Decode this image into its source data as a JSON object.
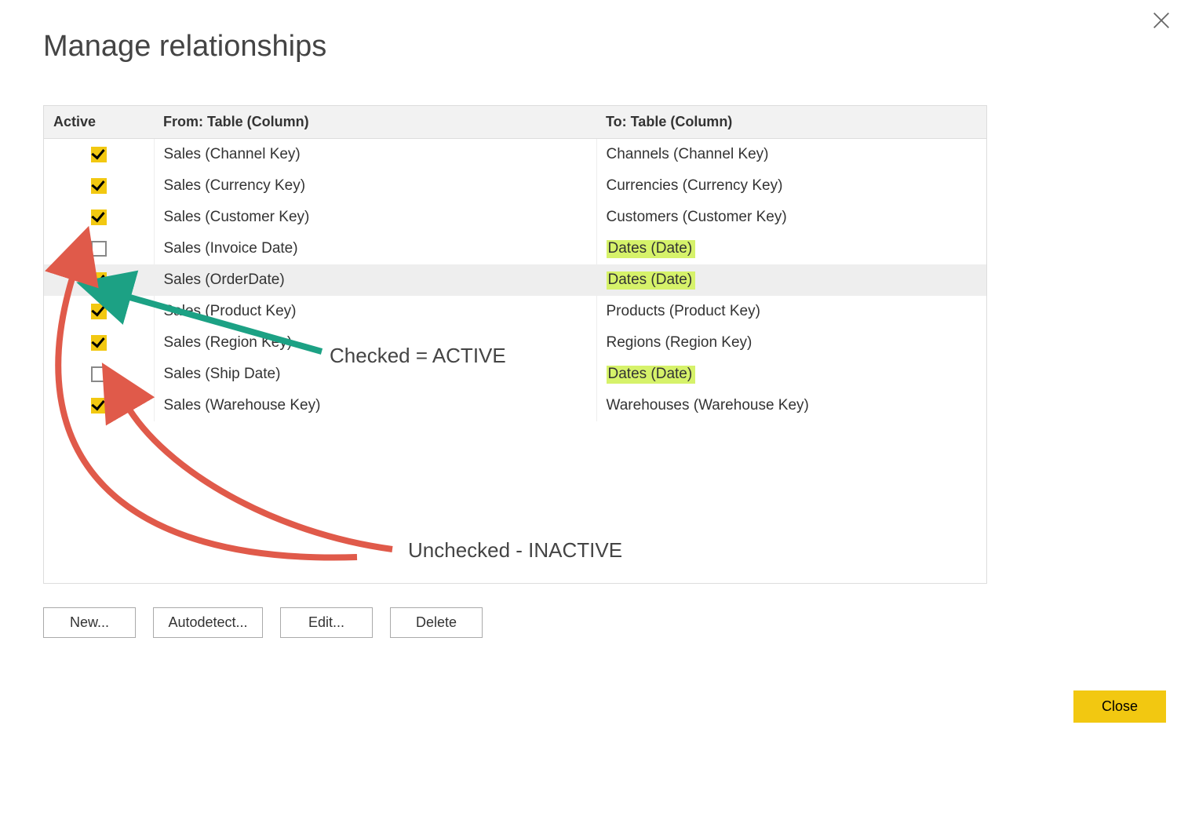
{
  "dialog": {
    "title": "Manage relationships",
    "close_icon": "close-icon"
  },
  "table": {
    "headers": {
      "active": "Active",
      "from": "From: Table (Column)",
      "to": "To: Table (Column)"
    },
    "rows": [
      {
        "active": true,
        "from": "Sales (Channel Key)",
        "to": "Channels (Channel Key)",
        "to_highlight": false,
        "selected": false
      },
      {
        "active": true,
        "from": "Sales (Currency Key)",
        "to": "Currencies (Currency Key)",
        "to_highlight": false,
        "selected": false
      },
      {
        "active": true,
        "from": "Sales (Customer Key)",
        "to": "Customers (Customer Key)",
        "to_highlight": false,
        "selected": false
      },
      {
        "active": false,
        "from": "Sales (Invoice Date)",
        "to": "Dates (Date)",
        "to_highlight": true,
        "selected": false
      },
      {
        "active": true,
        "from": "Sales (OrderDate)",
        "to": "Dates (Date)",
        "to_highlight": true,
        "selected": true
      },
      {
        "active": true,
        "from": "Sales (Product Key)",
        "to": "Products (Product Key)",
        "to_highlight": false,
        "selected": false
      },
      {
        "active": true,
        "from": "Sales (Region Key)",
        "to": "Regions (Region Key)",
        "to_highlight": false,
        "selected": false
      },
      {
        "active": false,
        "from": "Sales (Ship Date)",
        "to": "Dates (Date)",
        "to_highlight": true,
        "selected": false
      },
      {
        "active": true,
        "from": "Sales (Warehouse Key)",
        "to": "Warehouses (Warehouse Key)",
        "to_highlight": false,
        "selected": false
      }
    ]
  },
  "buttons": {
    "new": "New...",
    "autodetect": "Autodetect...",
    "edit": "Edit...",
    "delete": "Delete",
    "close": "Close"
  },
  "annotations": {
    "checked_label": "Checked = ACTIVE",
    "unchecked_label": "Unchecked - INACTIVE",
    "colors": {
      "green_arrow": "#1ca184",
      "red_arrow": "#e05a4a"
    }
  }
}
